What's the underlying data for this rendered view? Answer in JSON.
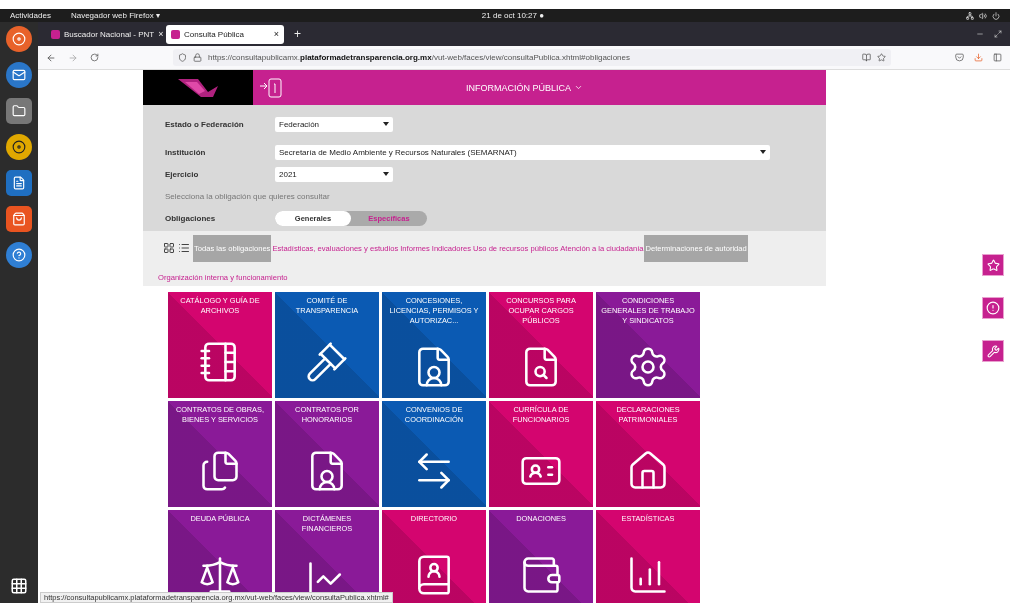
{
  "topbar": {
    "activities": "Actividades",
    "app_menu": "Navegador web Firefox ▾",
    "clock": "21 de oct  10:27 ●"
  },
  "browser": {
    "tabs": [
      {
        "title": "Buscador Nacional - PNT",
        "close": "×",
        "selected": false
      },
      {
        "title": "Consulta Pública",
        "close": "×",
        "selected": true
      }
    ],
    "new_tab": "+",
    "url_host_prefix": "https://consultapublicamx.",
    "url_host": "plataformadetransparencia.org.mx",
    "url_path": "/vut-web/faces/view/consultaPublica.xhtml#obligaciones",
    "status_url": "https://consultapublicamx.plataformadetransparencia.org.mx/vut-web/faces/view/consultaPublica.xhtml#"
  },
  "header": {
    "title": "INFORMACIÓN PÚBLICA"
  },
  "form": {
    "fields": [
      {
        "label": "Estado o Federación",
        "value": "Federación",
        "wide": false
      },
      {
        "label": "Institución",
        "value": "Secretaría de Medio Ambiente y Recursos Naturales (SEMARNAT)",
        "wide": true
      },
      {
        "label": "Ejercicio",
        "value": "2021",
        "wide": false
      }
    ],
    "hint": "Selecciona la obligación que quieres consultar",
    "toggle_label": "Obligaciones",
    "toggle": [
      {
        "label": "Generales",
        "selected": true
      },
      {
        "label": "Específicas",
        "selected": false
      }
    ]
  },
  "filters": [
    {
      "label": "Todas las obligaciones",
      "selected": true
    },
    {
      "label": "Estadísticas, evaluaciones y estudios",
      "selected": false
    },
    {
      "label": "Informes",
      "selected": false
    },
    {
      "label": "Indicadores",
      "selected": false
    },
    {
      "label": "Uso de recursos públicos",
      "selected": false
    },
    {
      "label": "Atención a la ciudadanía",
      "selected": false
    },
    {
      "label": "Determinaciones de autoridad",
      "selected": true
    },
    {
      "label": "Organización interna y funcionamiento",
      "selected": false
    }
  ],
  "tiles": [
    {
      "title": "CATÁLOGO Y GUÍA DE ARCHIVOS",
      "color": "#d4056f"
    },
    {
      "title": "COMITÉ DE TRANSPARENCIA",
      "color": "#0b5ab3"
    },
    {
      "title": "CONCESIONES, LICENCIAS, PERMISOS Y AUTORIZAC...",
      "color": "#0b5ab3"
    },
    {
      "title": "CONCURSOS PARA OCUPAR CARGOS PÚBLICOS",
      "color": "#d4056f"
    },
    {
      "title": "CONDICIONES GENERALES DE TRABAJO Y SINDICATOS",
      "color": "#8a1a98"
    },
    {
      "title": "CONTRATOS DE OBRAS, BIENES Y SERVICIOS",
      "color": "#8a1a98"
    },
    {
      "title": "CONTRATOS POR HONORARIOS",
      "color": "#8a1a98"
    },
    {
      "title": "CONVENIOS DE COORDINACIÓN",
      "color": "#0b5ab3"
    },
    {
      "title": "CURRÍCULA DE FUNCIONARIOS",
      "color": "#d4056f"
    },
    {
      "title": "DECLARACIONES PATRIMONIALES",
      "color": "#d4056f"
    },
    {
      "title": "DEUDA PÚBLICA",
      "color": "#8a1a98"
    },
    {
      "title": "DICTÁMENES FINANCIEROS",
      "color": "#8a1a98"
    },
    {
      "title": "DIRECTORIO",
      "color": "#d4056f"
    },
    {
      "title": "DONACIONES",
      "color": "#8a1a98"
    },
    {
      "title": "ESTADÍSTICAS",
      "color": "#d4056f"
    }
  ]
}
